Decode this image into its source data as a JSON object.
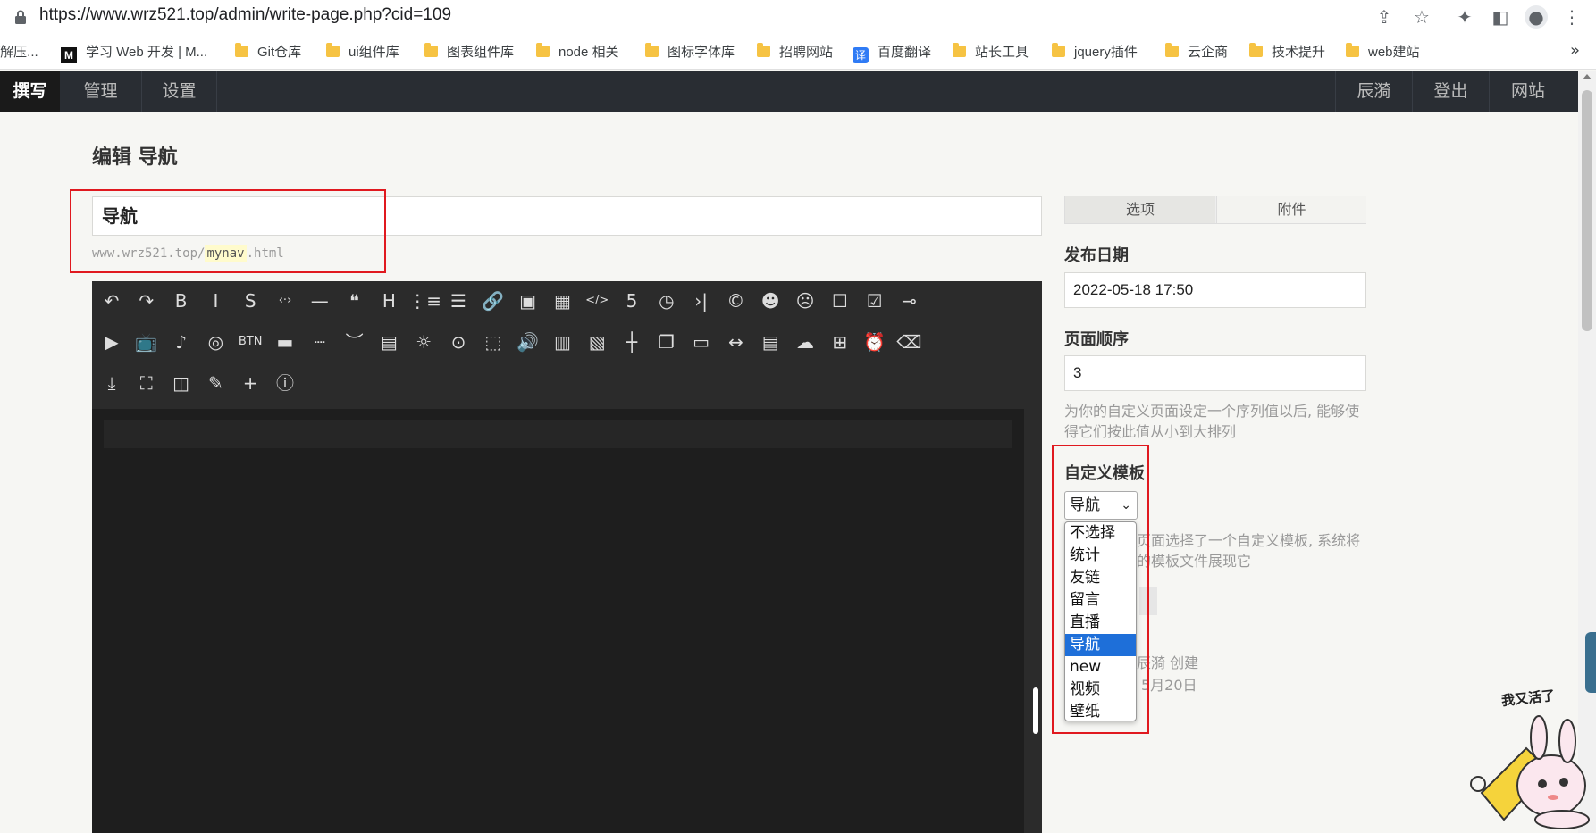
{
  "browser": {
    "url": "https://www.wrz521.top/admin/write-page.php?cid=109",
    "bookmarks": [
      {
        "label": "/解压...",
        "icon": "none"
      },
      {
        "label": "学习 Web 开发 | M...",
        "icon": "mdn-logo"
      },
      {
        "label": "Git仓库",
        "icon": "folder-icon"
      },
      {
        "label": "ui组件库",
        "icon": "folder-icon"
      },
      {
        "label": "图表组件库",
        "icon": "folder-icon"
      },
      {
        "label": "node 相关",
        "icon": "folder-icon"
      },
      {
        "label": "图标字体库",
        "icon": "folder-icon"
      },
      {
        "label": "招聘网站",
        "icon": "folder-icon"
      },
      {
        "label": "百度翻译",
        "icon": "translate-icon",
        "badge": "译"
      },
      {
        "label": "站长工具",
        "icon": "folder-icon"
      },
      {
        "label": "jquery插件",
        "icon": "folder-icon"
      },
      {
        "label": "云企商",
        "icon": "folder-icon"
      },
      {
        "label": "技术提升",
        "icon": "folder-icon"
      },
      {
        "label": "web建站",
        "icon": "folder-icon"
      }
    ],
    "more": "»",
    "mdn_logo_text": "M"
  },
  "nav": {
    "left": [
      "撰写",
      "管理",
      "设置"
    ],
    "right": [
      "辰漪",
      "登出",
      "网站"
    ]
  },
  "main": {
    "page_title": "编辑 导航",
    "title_value": "导航",
    "slug_prefix": "www.wrz521.top/",
    "slug_value": "mynav",
    "slug_suffix": ".html"
  },
  "editor": {
    "toolbar_icons": [
      [
        "undo-icon",
        "redo-icon",
        "bold-icon",
        "italic-icon",
        "strikethrough-icon",
        "code-inline-icon",
        "hr-icon",
        "quote-icon",
        "heading-icon",
        "ordered-list-icon",
        "unordered-list-icon",
        "link-icon",
        "image-icon",
        "table-icon",
        "code-block-icon",
        "html5-icon",
        "clock-icon",
        "more-icon",
        "copyright-icon",
        "emoji-smile-icon",
        "emoji-sad-icon",
        "checkbox-empty-icon",
        "checkbox-checked-icon",
        "toggle-icon"
      ],
      [
        "video-icon",
        "tv-icon",
        "music-icon",
        "netease-icon",
        "btn-icon",
        "bar-icon",
        "dashes-icon",
        "hide-icon",
        "card-icon",
        "bulb-icon",
        "switch-icon",
        "frame-icon",
        "audio-icon",
        "gallery-icon",
        "note-icon",
        "timeline-icon",
        "copy-icon",
        "tabs-icon",
        "line-icon",
        "panel-icon",
        "cloud-icon",
        "grid-icon",
        "alarm-icon",
        "eraser-icon"
      ],
      [
        "download-icon",
        "fullscreen-icon",
        "window-icon",
        "pencil-icon",
        "plus-icon",
        "info-icon"
      ]
    ],
    "toolbar_glyphs": {
      "undo-icon": "↶",
      "redo-icon": "↷",
      "bold-icon": "B",
      "italic-icon": "I",
      "strikethrough-icon": "S",
      "code-inline-icon": "‹·›",
      "hr-icon": "—",
      "quote-icon": "❝",
      "heading-icon": "H",
      "ordered-list-icon": "⋮≡",
      "unordered-list-icon": "☰",
      "link-icon": "🔗",
      "image-icon": "▣",
      "table-icon": "▦",
      "code-block-icon": "</>",
      "html5-icon": "5",
      "clock-icon": "◷",
      "more-icon": "›|",
      "copyright-icon": "©",
      "emoji-smile-icon": "☻",
      "emoji-sad-icon": "☹",
      "checkbox-empty-icon": "☐",
      "checkbox-checked-icon": "☑",
      "toggle-icon": "⊸",
      "video-icon": "▶",
      "tv-icon": "📺",
      "music-icon": "♪",
      "netease-icon": "◎",
      "btn-icon": "BTN",
      "bar-icon": "▬",
      "dashes-icon": "┈",
      "hide-icon": "︶",
      "card-icon": "▤",
      "bulb-icon": "☼",
      "switch-icon": "⊙",
      "frame-icon": "⬚",
      "audio-icon": "🔊",
      "gallery-icon": "▥",
      "note-icon": "▧",
      "timeline-icon": "┼",
      "copy-icon": "❐",
      "tabs-icon": "▭",
      "line-icon": "↔",
      "panel-icon": "▤",
      "cloud-icon": "☁",
      "grid-icon": "⊞",
      "alarm-icon": "⏰",
      "eraser-icon": "⌫",
      "download-icon": "⤓",
      "fullscreen-icon": "⛶",
      "window-icon": "◫",
      "pencil-icon": "✎",
      "plus-icon": "+",
      "info-icon": "ⓘ"
    }
  },
  "sidebar": {
    "tabs": [
      "选项",
      "附件"
    ],
    "publish_date_label": "发布日期",
    "publish_date_value": "2022-05-18 17:50",
    "order_label": "页面顺序",
    "order_value": "3",
    "order_hint": [
      "为你的自定义页面设定一个序列值以后, 能够使",
      "得它们按此值从小到大排列"
    ],
    "template_label": "自定义模板",
    "template_selected": "导航",
    "template_hint": [
      "页面选择了一个自定义模板, 系统将",
      "的模板文件展现它"
    ],
    "template_options": [
      "不选择",
      "统计",
      "友链",
      "留言",
      "直播",
      "导航",
      "new",
      "视频",
      "壁纸"
    ],
    "created_by": "辰漪 创建",
    "created_date": "5月20日"
  },
  "mascot": {
    "caption": "我又活了",
    "mascot_text": "我又活了"
  },
  "colors": {
    "nav_bg": "#292d33",
    "editor_bg": "#2b2b2b",
    "highlight_box": "#e0191f",
    "selected_option": "#1e6fd9"
  }
}
